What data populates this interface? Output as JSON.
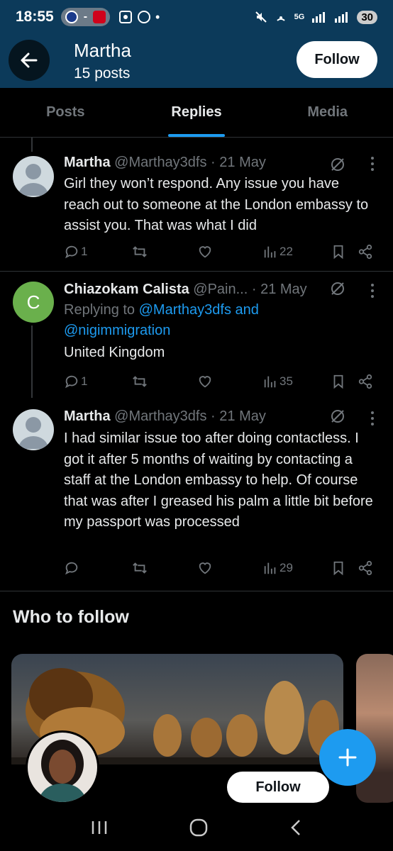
{
  "status_bar": {
    "time": "18:55",
    "pill_sep": "-",
    "net": "5G",
    "battery": "30"
  },
  "header": {
    "name": "Martha",
    "posts": "15 posts",
    "follow_label": "Follow"
  },
  "tabs": [
    {
      "label": "Posts"
    },
    {
      "label": "Replies"
    },
    {
      "label": "Media"
    }
  ],
  "tweets": [
    {
      "name": "Martha",
      "meta": " @Marthay3dfs · 21 May",
      "text": "Girl they won’t respond. Any issue you have reach out to someone at the London embassy to assist you. That was what I did",
      "replies": "1",
      "reposts": "",
      "likes": "",
      "views": "22"
    },
    {
      "name": "Chiazokam Calista",
      "meta": " @Pain... · 21 May",
      "avatar_letter": "C",
      "replying_prefix": "Replying to ",
      "replying_to": "@Marthay3dfs and @nigimmigration",
      "text": "United Kingdom",
      "replies": "1",
      "reposts": "",
      "likes": "",
      "views": "35"
    },
    {
      "name": "Martha",
      "meta": " @Marthay3dfs · 21 May",
      "text": "I had similar issue too after doing contactless. I got it after 5 months of waiting by contacting a staff at the London embassy to help. Of course that was after I greased his palm a little bit before my passport was processed",
      "replies": "",
      "reposts": "",
      "likes": "",
      "views": "29"
    }
  ],
  "who_to_follow": {
    "title": "Who to follow",
    "follow_label": "Follow"
  },
  "colors": {
    "accent": "#1d9bf0",
    "header_bg": "#0c3a5a",
    "muted": "#71767b",
    "text": "#e7e9ea"
  },
  "icons": [
    "back-arrow-icon",
    "grok-icon",
    "more-icon",
    "reply-icon",
    "repost-icon",
    "like-icon",
    "views-icon",
    "bookmark-icon",
    "share-icon",
    "compose-plus-icon",
    "recents-icon",
    "home-icon",
    "back-icon"
  ]
}
